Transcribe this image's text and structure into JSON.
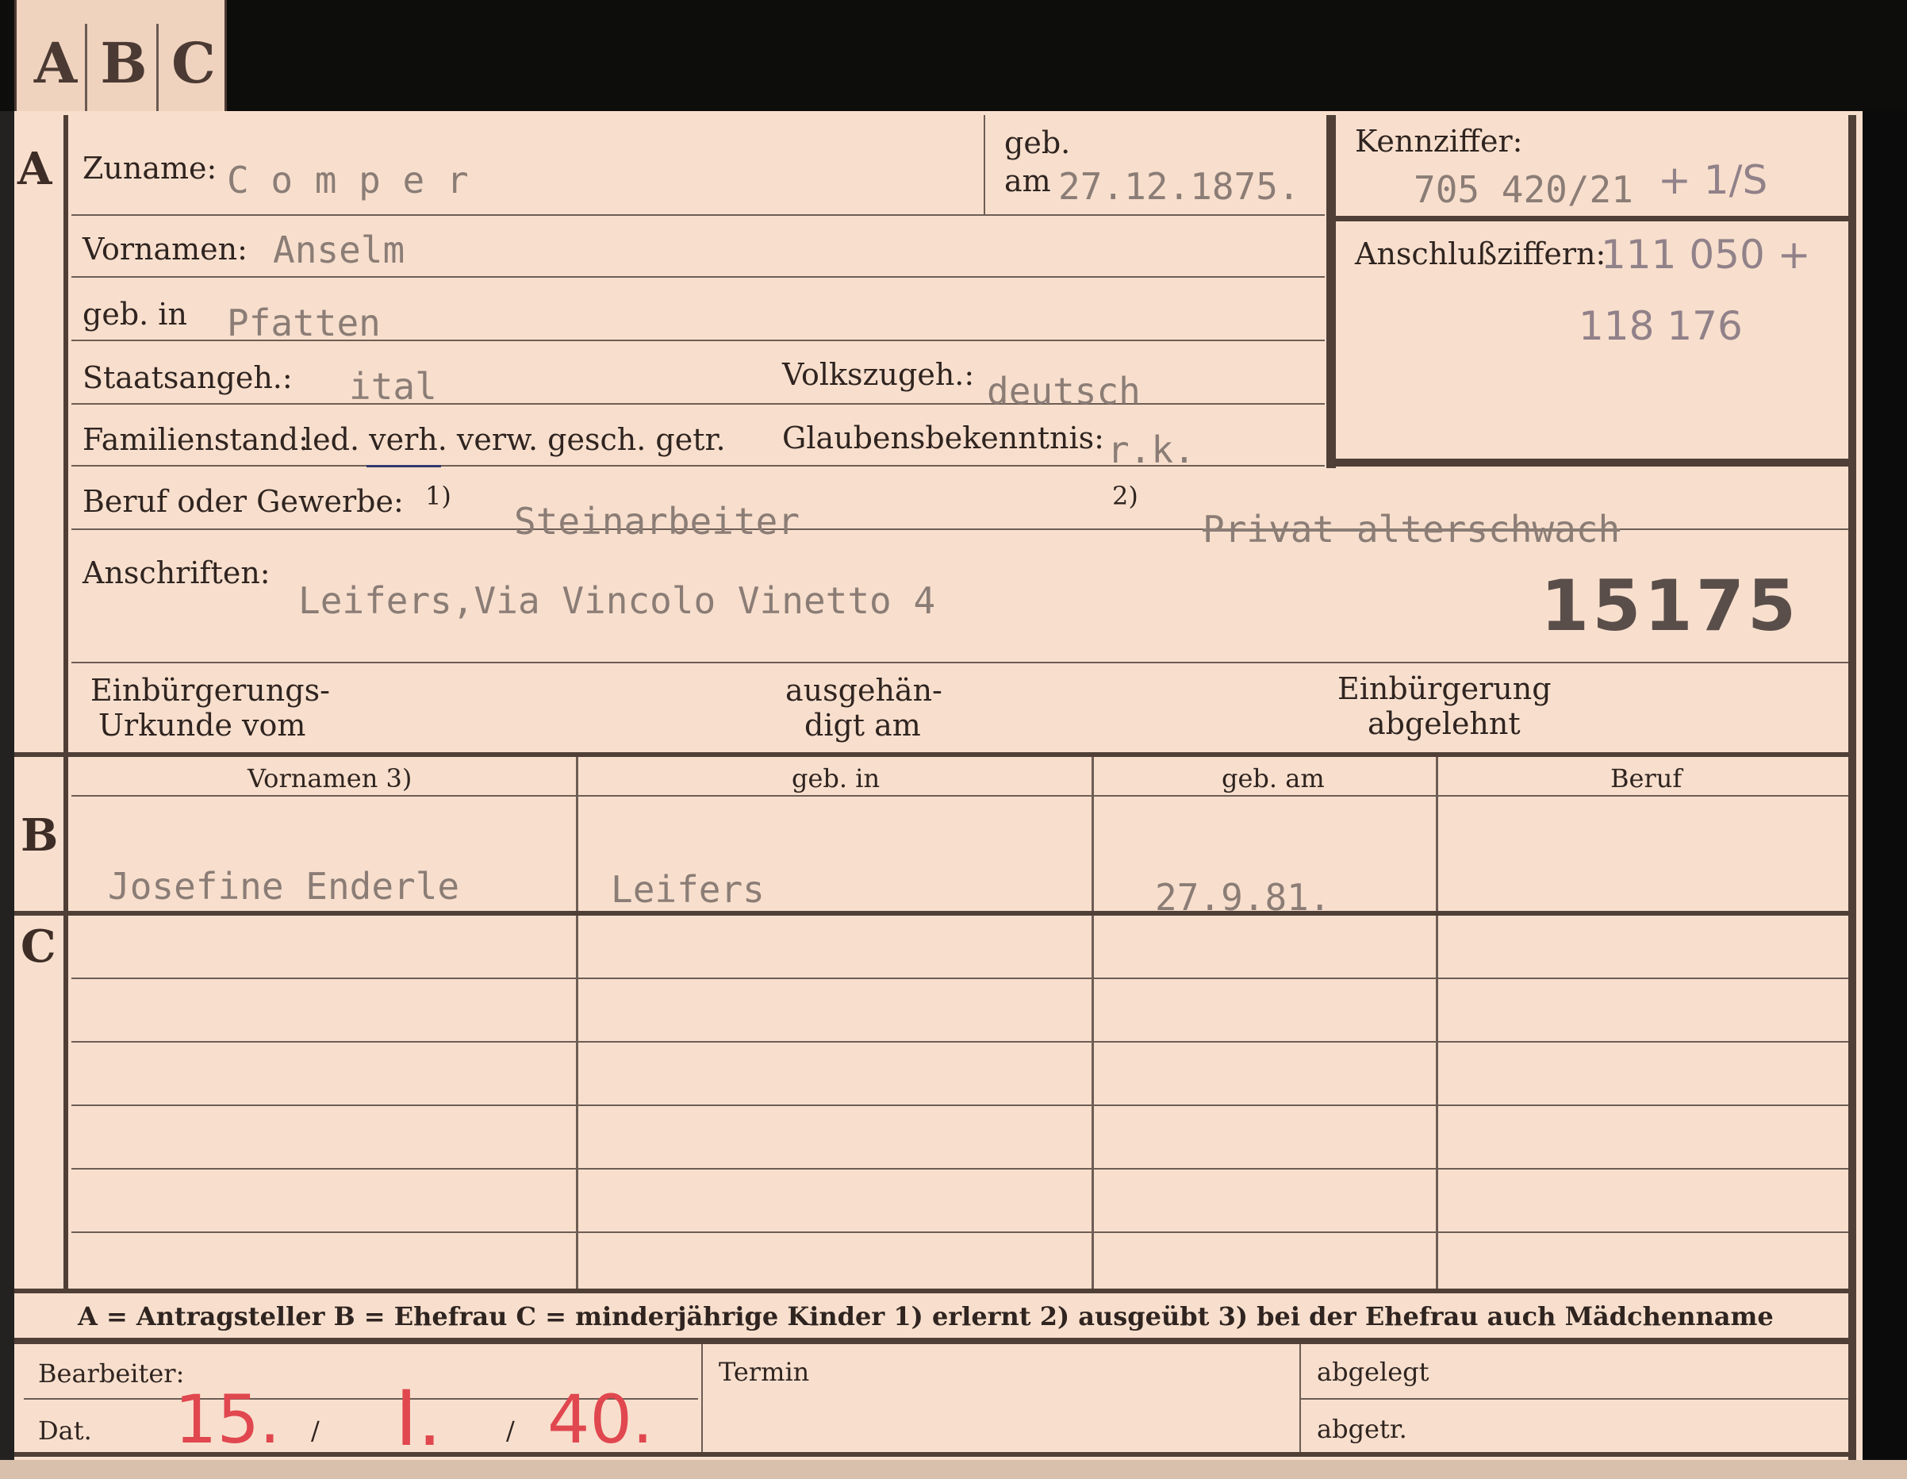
{
  "tabs": [
    "A",
    "B",
    "C"
  ],
  "sections": {
    "a": "A",
    "b": "B",
    "c": "C"
  },
  "labels": {
    "zuname": "Zuname:",
    "geb": "geb.",
    "am": "am",
    "kennziffer": "Kennziffer:",
    "vornamen": "Vornamen:",
    "anschlussziffern": "Anschlußziffern:",
    "geb_in": "geb. in",
    "staatsangeh": "Staatsangeh.:",
    "volkszugeh": "Volkszugeh.:",
    "familienstand": "Familienstand:",
    "familienstand_options": "led. verh. verw. gesch. getr.",
    "glaubensbekenntnis": "Glaubensbekenntnis:",
    "beruf": "Beruf oder Gewerbe:",
    "fn1": "1)",
    "fn2": "2)",
    "anschriften": "Anschriften:",
    "einbuergerungs_1": "Einbürgerungs-",
    "einbuergerungs_2": "Urkunde vom",
    "ausgehaen_1": "ausgehän-",
    "ausgehaen_2": "digt am",
    "einbuergerung_1": "Einbürgerung",
    "einbuergerung_2": "abgelehnt"
  },
  "values": {
    "zuname": "C o m p e r",
    "geb_am": "27.12.1875.",
    "kennziffer": "705 420/21",
    "kennziffer_hand": "+ 1/S",
    "vornamen": "Anselm",
    "geb_in": "Pfatten",
    "staatsangeh": "ital",
    "volkszugeh": "deutsch",
    "glaubensbekenntnis": "r.k.",
    "beruf_1": "Steinarbeiter",
    "beruf_2": "Privat alterschwach",
    "anschriften": "Leifers,Via Vincolo Vinetto 4",
    "anschluss_1": "111 050 +",
    "anschluss_2": "118 176",
    "stamp_number": "15175"
  },
  "table": {
    "headers": [
      "Vornamen 3)",
      "geb. in",
      "geb. am",
      "Beruf"
    ],
    "spouse": [
      "Josefine Enderle",
      "Leifers",
      "27.9.81.",
      ""
    ]
  },
  "legend": "A = Antragsteller   B = Ehefrau   C = minderjährige Kinder   1) erlernt   2) ausgeübt   3) bei der Ehefrau auch Mädchenname",
  "footer": {
    "bearbeiter": "Bearbeiter:",
    "dat": "Dat.",
    "termin": "Termin",
    "abgelegt": "abgelegt",
    "abgetr": "abgetr.",
    "date_day": "15.",
    "date_month": "I.",
    "date_year": "40.",
    "date_sep": "/"
  }
}
